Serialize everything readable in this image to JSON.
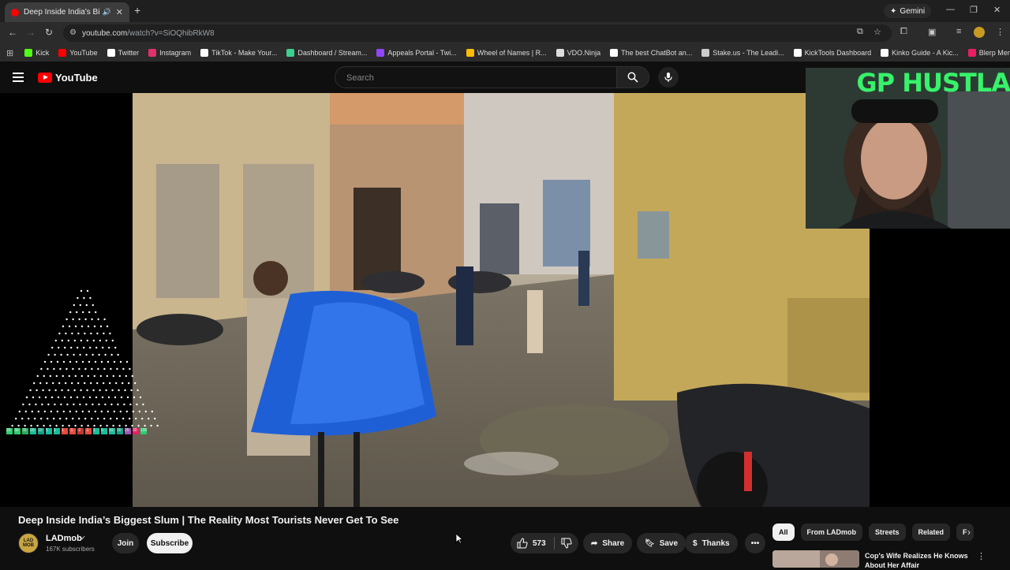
{
  "browser": {
    "tab_title": "Deep Inside India's Biggest",
    "new_tab": "+",
    "gemini_label": "Gemini",
    "url_host": "youtube.com",
    "url_path": "/watch?v=SiOQhibRkW8",
    "bookmarks": [
      {
        "label": "Kick",
        "color": "#53fc18"
      },
      {
        "label": "YouTube",
        "color": "#ff0000"
      },
      {
        "label": "Twitter",
        "color": "#ffffff"
      },
      {
        "label": "Instagram",
        "color": "#e1306c"
      },
      {
        "label": "TikTok - Make Your...",
        "color": "#ffffff"
      },
      {
        "label": "Dashboard / Stream...",
        "color": "#3ecf8e"
      },
      {
        "label": "Appeals Portal - Twi...",
        "color": "#9146ff"
      },
      {
        "label": "Wheel of Names | R...",
        "color": "#fbbc05"
      },
      {
        "label": "VDO.Ninja",
        "color": "#dddddd"
      },
      {
        "label": "The best ChatBot an...",
        "color": "#ffffff"
      },
      {
        "label": "Stake.us - The Leadi...",
        "color": "#cccccc"
      },
      {
        "label": "KickTools Dashboard",
        "color": "#ffffff"
      },
      {
        "label": "Kinko Guide - A Kic...",
        "color": "#ffffff"
      },
      {
        "label": "Blerp Memes | Best...",
        "color": "#e91e63"
      }
    ]
  },
  "youtube": {
    "logo_text": "YouTube",
    "search_placeholder": "Search"
  },
  "webcam": {
    "overlay_text": "GP HUSTLA"
  },
  "video": {
    "title": "Deep Inside India’s Biggest Slum | The Reality Most Tourists Never Get To See",
    "channel_name": "LADmob",
    "channel_avatar_text": "LAD MOB",
    "subscribers": "167K subscribers",
    "join_label": "Join",
    "subscribe_label": "Subscribe",
    "likes": "573",
    "share_label": "Share",
    "save_label": "Save",
    "thanks_label": "Thanks"
  },
  "sidebar": {
    "chips": [
      "All",
      "From LADmob",
      "Streets",
      "Related",
      "F"
    ],
    "recommended_title": "Cop's Wife Realizes He Knows About Her Affair"
  },
  "overlay_counter": [
    "20",
    "30",
    "35",
    "20",
    "10",
    "5",
    "1",
    "1",
    "-1",
    "-2",
    "-1",
    "1",
    "5",
    "10",
    "20",
    "25",
    "30",
    "100"
  ],
  "colors": {
    "yt_red": "#ff0000",
    "brand_green": "#37f26a",
    "accent_chrome": "#c99a22"
  }
}
